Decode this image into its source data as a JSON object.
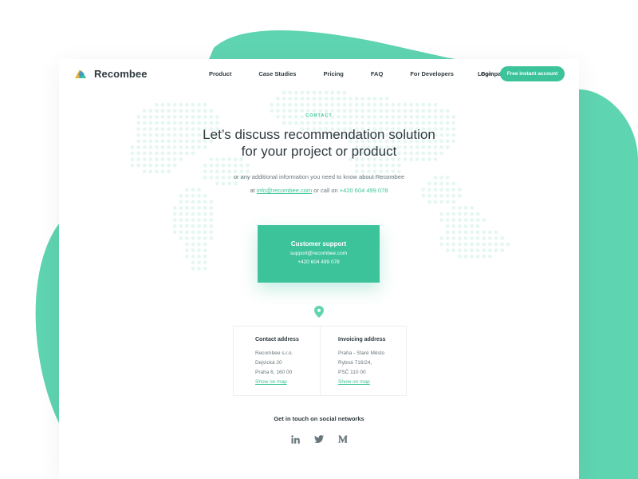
{
  "brand": {
    "name": "Recombee",
    "accent": "#3cc39a",
    "dark_text": "#2f3a3f"
  },
  "nav": {
    "items": [
      "Product",
      "Case Studies",
      "Pricing",
      "FAQ",
      "For Developers",
      "Company"
    ],
    "login": "Login",
    "cta": "Free instant account"
  },
  "hero": {
    "eyebrow": "CONTACT",
    "headline_line1": "Let’s discuss recommendation solution",
    "headline_line2": "for your project or product",
    "sub_line1": "or any additional information you need to know about Recombee",
    "sub_at": "at",
    "email": "info@recombee.com",
    "or_call": "or call on",
    "phone": "+420 604 499 078"
  },
  "support": {
    "title": "Customer support",
    "email": "support@recombee.com",
    "phone": "+420 604 499 078"
  },
  "addresses": {
    "contact": {
      "title": "Contact address",
      "lines": [
        "Recombee s.r.o.",
        "Dejvická 20",
        "Praha 6, 160 00"
      ],
      "link": "Show on map"
    },
    "invoicing": {
      "title": "Invoicing address",
      "lines": [
        "Praha - Staré Město",
        "Rybná 716/24,",
        "PSČ 110 00"
      ],
      "link": "Show on map"
    }
  },
  "social": {
    "title": "Get in touch on social networks",
    "icons": [
      "linkedin-icon",
      "twitter-icon",
      "medium-icon"
    ]
  }
}
